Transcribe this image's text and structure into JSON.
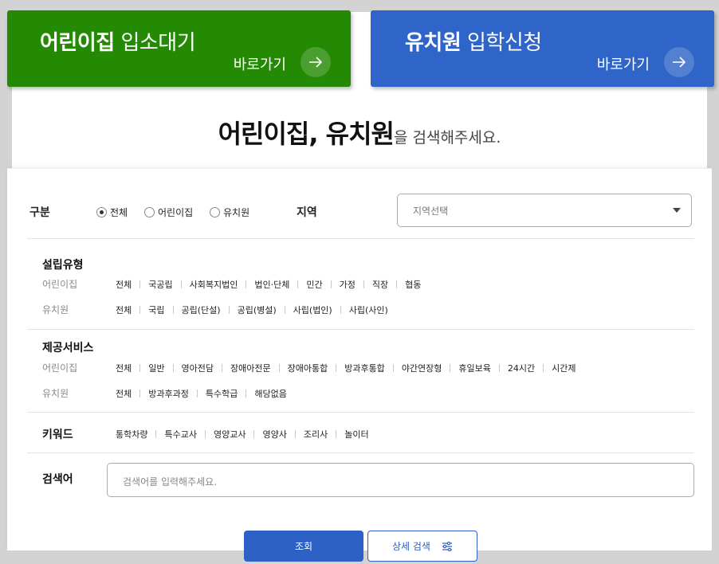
{
  "banners": {
    "daycare": {
      "title_bold": "어린이집",
      "title_light": "입소대기",
      "go_label": "바로가기"
    },
    "kindergarten": {
      "title_bold": "유치원",
      "title_light": "입학신청",
      "go_label": "바로가기"
    }
  },
  "headline": {
    "strong": "어린이집, 유치원",
    "rest": "을 검색해주세요."
  },
  "category": {
    "label": "구분",
    "options": [
      "전체",
      "어린이집",
      "유치원"
    ],
    "selected": "전체"
  },
  "region": {
    "label": "지역",
    "placeholder": "지역선택"
  },
  "establishment": {
    "title": "설립유형",
    "daycare_label": "어린이집",
    "daycare_items": [
      "전체",
      "국공립",
      "사회복지법인",
      "법인·단체",
      "민간",
      "가정",
      "직장",
      "협동"
    ],
    "kindergarten_label": "유치원",
    "kindergarten_items": [
      "전체",
      "국립",
      "공립(단설)",
      "공립(병설)",
      "사립(법인)",
      "사립(사인)"
    ]
  },
  "services": {
    "title": "제공서비스",
    "daycare_label": "어린이집",
    "daycare_items": [
      "전체",
      "일반",
      "영아전담",
      "장애아전문",
      "장애아통합",
      "방과후통합",
      "야간연장형",
      "휴일보육",
      "24시간",
      "시간제"
    ],
    "kindergarten_label": "유치원",
    "kindergarten_items": [
      "전체",
      "방과후과정",
      "특수학급",
      "해당없음"
    ]
  },
  "keyword": {
    "title": "키워드",
    "items": [
      "통학차량",
      "특수교사",
      "영양교사",
      "영양사",
      "조리사",
      "놀이터"
    ]
  },
  "search": {
    "label": "검색어",
    "placeholder": "검색어를 입력해주세요."
  },
  "buttons": {
    "submit": "조회",
    "advanced": "상세 검색"
  },
  "colors": {
    "green": "#248a04",
    "blue": "#2f64c8"
  }
}
